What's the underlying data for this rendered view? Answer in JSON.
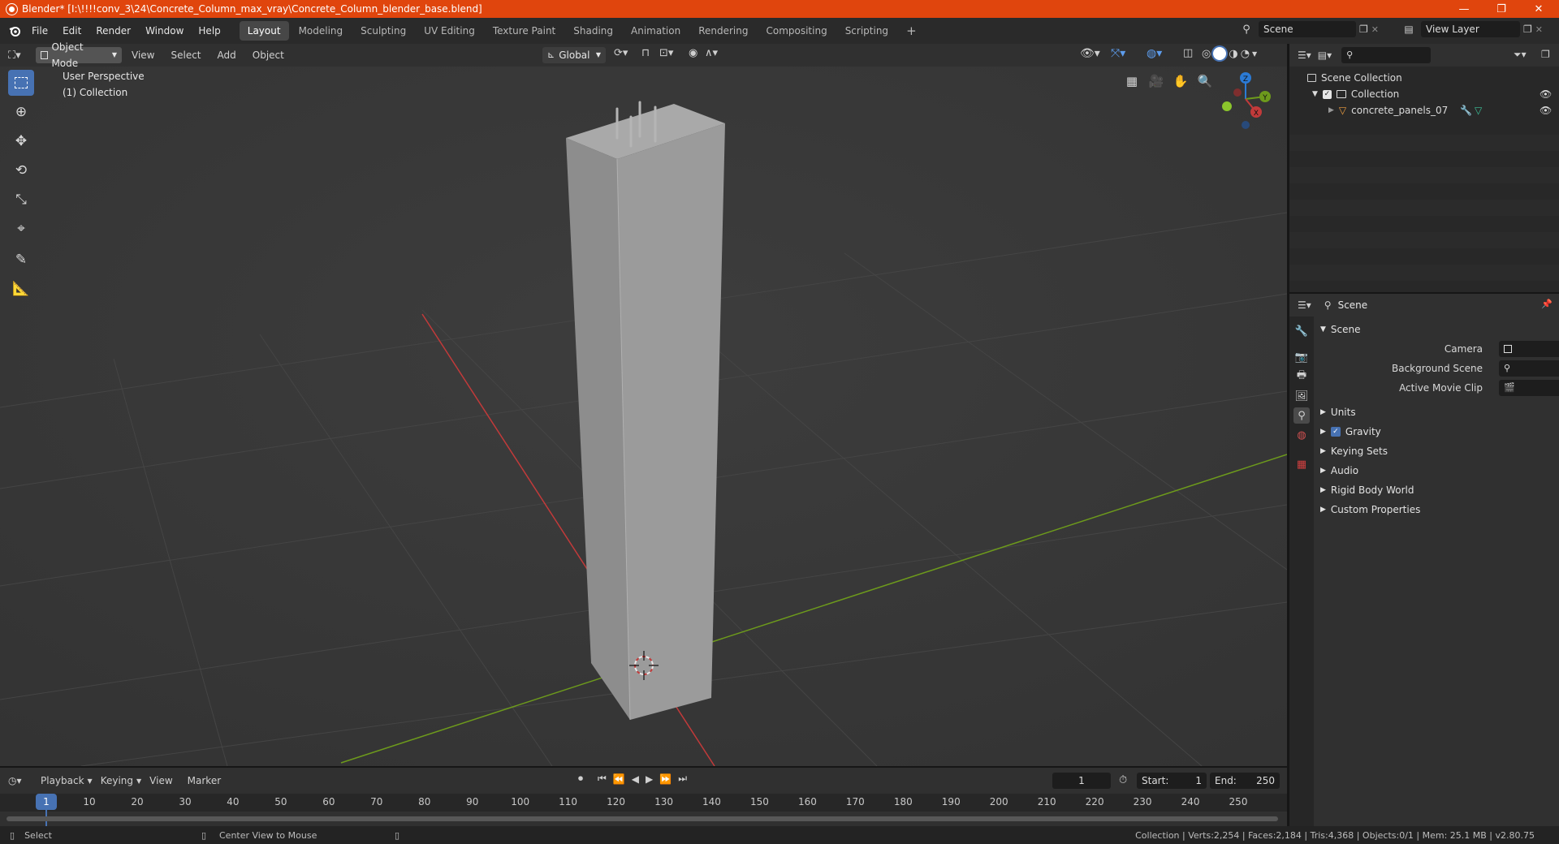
{
  "window": {
    "title": "Blender* [I:\\!!!!conv_3\\24\\Concrete_Column_max_vray\\Concrete_Column_blender_base.blend]",
    "controls": [
      "—",
      "❐",
      "✕"
    ]
  },
  "menu": {
    "items": [
      "File",
      "Edit",
      "Render",
      "Window",
      "Help"
    ],
    "workspaces": [
      "Layout",
      "Modeling",
      "Sculpting",
      "UV Editing",
      "Texture Paint",
      "Shading",
      "Animation",
      "Rendering",
      "Compositing",
      "Scripting"
    ],
    "active_workspace": "Layout",
    "add_workspace": "+",
    "scene": "Scene",
    "view_layer": "View Layer"
  },
  "viewport_header": {
    "mode": "Object Mode",
    "menus": [
      "View",
      "Select",
      "Add",
      "Object"
    ],
    "orientation": "Global"
  },
  "viewport": {
    "overlay_line1": "User Perspective",
    "overlay_line2": "(1) Collection",
    "gizmo": {
      "x": "X",
      "y": "Y",
      "z": "Z"
    }
  },
  "outliner": {
    "search_placeholder": "",
    "scene_collection": "Scene Collection",
    "collection": "Collection",
    "object": "concrete_panels_07"
  },
  "properties": {
    "breadcrumb": "Scene",
    "panel_title": "Scene",
    "fields": [
      {
        "label": "Camera",
        "value": ""
      },
      {
        "label": "Background Scene",
        "value": ""
      },
      {
        "label": "Active Movie Clip",
        "value": ""
      }
    ],
    "sections": [
      "Units",
      "Gravity",
      "Keying Sets",
      "Audio",
      "Rigid Body World",
      "Custom Properties"
    ],
    "gravity_checked": true
  },
  "timeline": {
    "menus": [
      "Playback",
      "Keying",
      "View",
      "Marker"
    ],
    "current_frame": "1",
    "start_label": "Start:",
    "start": "1",
    "end_label": "End:",
    "end": "250",
    "ticks": [
      "1",
      "10",
      "20",
      "30",
      "40",
      "50",
      "60",
      "70",
      "80",
      "90",
      "100",
      "110",
      "120",
      "130",
      "140",
      "150",
      "160",
      "170",
      "180",
      "190",
      "200",
      "210",
      "220",
      "230",
      "240",
      "250"
    ]
  },
  "statusbar": {
    "left_action": "Select",
    "middle_action": "Center View to Mouse",
    "stats": "Collection | Verts:2,254 | Faces:2,184 | Tris:4,368 | Objects:0/1 | Mem: 25.1 MB | v2.80.75"
  },
  "colors": {
    "title_bar": "#e0450d",
    "accent": "#4772b3",
    "axis_x": "#c23a3a",
    "axis_y": "#6d9a1c",
    "axis_z": "#2b7bd6"
  }
}
